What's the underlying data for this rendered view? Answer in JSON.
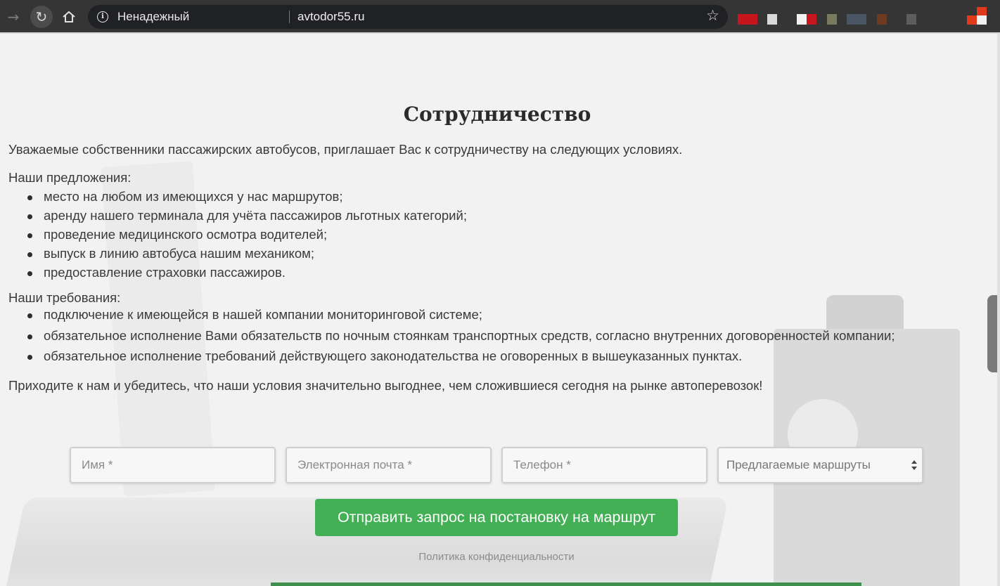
{
  "browser": {
    "security_label": "Ненадежный",
    "url": "avtodor55.ru",
    "extension_colors": [
      "#c6161c",
      "#d9d9d9",
      "#f2f2f2",
      "#c8161e",
      "#7a7a5e",
      "#4a5663",
      "#6e3b22",
      "#5d5d5d",
      "#e0391c"
    ]
  },
  "page": {
    "title": "Сотрудничество",
    "intro": "Уважаемые собственники пассажирских автобусов, приглашает Вас к сотрудничеству на следующих условиях.",
    "offers_heading": "Наши предложения:",
    "offers": [
      "место на любом из имеющихся у нас маршрутов;",
      "аренду нашего терминала для учёта пассажиров льготных категорий;",
      "проведение медицинского осмотра водителей;",
      "выпуск в линию автобуса нашим механиком;",
      "предоставление страховки пассажиров."
    ],
    "requirements_heading": "Наши требования:",
    "requirements": [
      "подключение к имеющейся в нашей компании мониторинговой системе;",
      "обязательное исполнение Вами обязательств по ночным стоянкам транспортных средств, согласно внутренних договоренностей компании;",
      "обязательное исполнение требований действующего законодательства не оговоренных в вышеуказанных пунктах."
    ],
    "closing": "Приходите к нам и убедитесь, что наши условия значительно выгоднее, чем сложившиеся сегодня на рынке автоперевозок!"
  },
  "form": {
    "name_placeholder": "Имя *",
    "email_placeholder": "Электронная почта *",
    "phone_placeholder": "Телефон *",
    "routes_selected": "Предлагаемые маршруты",
    "submit_label": "Отправить запрос на постановку на маршрут",
    "privacy_link": "Политика конфиденциальности"
  },
  "colors": {
    "submit": "#43b055",
    "chrome": "#353535"
  }
}
